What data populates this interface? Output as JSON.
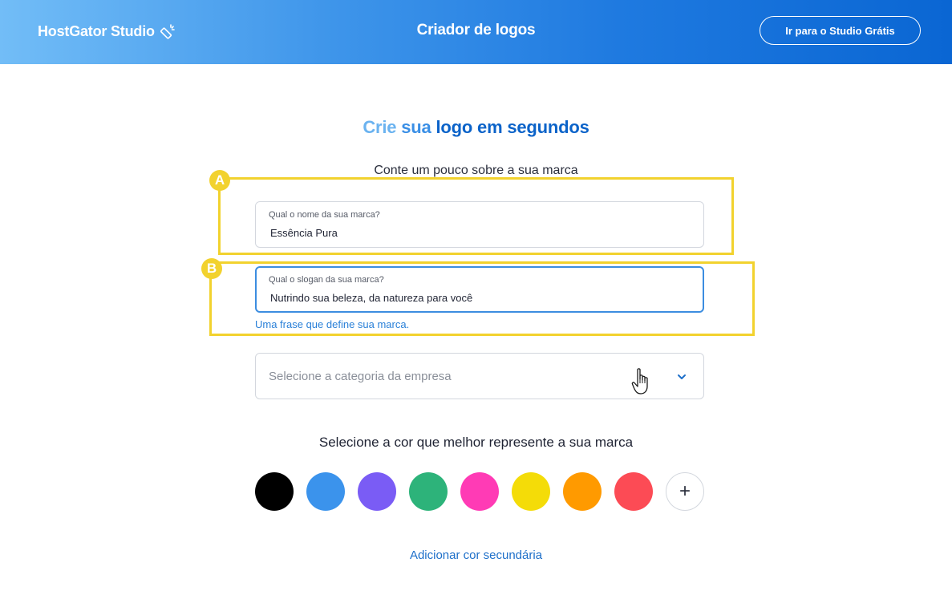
{
  "header": {
    "brand": "HostGator Studio",
    "title": "Criador de logos",
    "cta_label": "Ir para o Studio Grátis",
    "gradient_start": "#72bdf7",
    "gradient_end": "#0a66d3"
  },
  "main": {
    "title_parts": [
      "Crie",
      "sua",
      "logo em segundos"
    ],
    "subtitle": "Conte um pouco sobre a sua marca",
    "brand_name_field": {
      "label": "Qual o nome da sua marca?",
      "value": "Essência Pura"
    },
    "slogan_field": {
      "label": "Qual o slogan da sua marca?",
      "value": "Nutrindo sua beleza, da natureza para você",
      "helper": "Uma frase que define sua marca."
    },
    "category_select": {
      "placeholder": "Selecione a categoria da empresa",
      "icon": "chevron-down-icon"
    },
    "color_section": {
      "title": "Selecione a cor que melhor represente a sua marca",
      "colors": [
        {
          "name": "black",
          "hex": "#000000"
        },
        {
          "name": "blue",
          "hex": "#3b93ec"
        },
        {
          "name": "purple",
          "hex": "#7a5cf5"
        },
        {
          "name": "green",
          "hex": "#2db37a"
        },
        {
          "name": "pink",
          "hex": "#ff3bb5"
        },
        {
          "name": "yellow",
          "hex": "#f4dc08"
        },
        {
          "name": "orange",
          "hex": "#ff9a00"
        },
        {
          "name": "red",
          "hex": "#fc4b55"
        }
      ],
      "add_label": "+",
      "secondary_link": "Adicionar cor secundária"
    }
  },
  "annotations": {
    "a_label": "A",
    "b_label": "B",
    "color": "#f2d22e"
  }
}
